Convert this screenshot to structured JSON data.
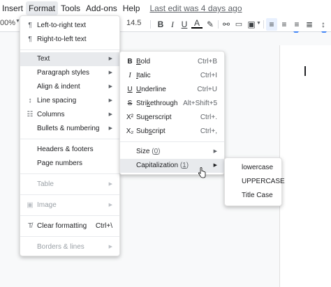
{
  "menubar": {
    "items": [
      "Insert",
      "Format",
      "Tools",
      "Add-ons",
      "Help"
    ],
    "last_edit": "Last edit was 4 days ago"
  },
  "toolbar": {
    "zoom": "00%",
    "font_size": "14.5",
    "icons": [
      "bold-icon",
      "italic-icon",
      "underline-icon",
      "text-color-icon",
      "highlight-icon",
      "link-icon",
      "comment-icon",
      "image-icon",
      "align-left-icon",
      "align-center-icon",
      "align-right-icon",
      "justify-icon"
    ]
  },
  "format_menu": {
    "items": [
      {
        "label": "Left-to-right text",
        "icon": "ltr-icon"
      },
      {
        "label": "Right-to-left text",
        "icon": "rtl-icon"
      },
      {
        "label": "Text",
        "submenu": true
      },
      {
        "label": "Paragraph styles",
        "submenu": true
      },
      {
        "label": "Align & indent",
        "submenu": true
      },
      {
        "label": "Line spacing",
        "submenu": true,
        "icon": "line-spacing-icon"
      },
      {
        "label": "Columns",
        "submenu": true,
        "icon": "columns-icon"
      },
      {
        "label": "Bullets & numbering",
        "submenu": true
      },
      {
        "label": "Headers & footers"
      },
      {
        "label": "Page numbers"
      },
      {
        "label": "Table",
        "submenu": true,
        "disabled": true
      },
      {
        "label": "Image",
        "submenu": true,
        "disabled": true,
        "icon": "image-icon"
      },
      {
        "label": "Clear formatting",
        "shortcut": "Ctrl+\\",
        "icon": "clear-formatting-icon"
      },
      {
        "label": "Borders & lines",
        "submenu": true,
        "disabled": true
      }
    ]
  },
  "text_menu": {
    "items": [
      {
        "glyph": "B",
        "label": "Bold",
        "u": "B",
        "rest": "old",
        "shortcut": "Ctrl+B"
      },
      {
        "glyph": "I",
        "label": "Italic",
        "u": "I",
        "rest": "talic",
        "shortcut": "Ctrl+I"
      },
      {
        "glyph": "U",
        "label": "Underline",
        "u": "U",
        "rest": "nderline",
        "shortcut": "Ctrl+U"
      },
      {
        "glyph": "S",
        "label": "Strikethrough",
        "u": "k",
        "pre": "Stri",
        "rest": "ethrough",
        "shortcut": "Alt+Shift+5"
      },
      {
        "glyph": "X²",
        "label": "Superscript",
        "u": "p",
        "pre": "Su",
        "rest": "erscript",
        "shortcut": "Ctrl+."
      },
      {
        "glyph": "X₂",
        "label": "Subscript",
        "u": "s",
        "pre": "Sub",
        "rest": "cript",
        "shortcut": "Ctrl+,"
      }
    ],
    "size": {
      "label": "Size",
      "count": "0"
    },
    "capitalization": {
      "label": "Capitalization",
      "count": "1"
    }
  },
  "cap_menu": {
    "items": [
      "lowercase",
      "UPPERCASE",
      "Title Case"
    ]
  }
}
